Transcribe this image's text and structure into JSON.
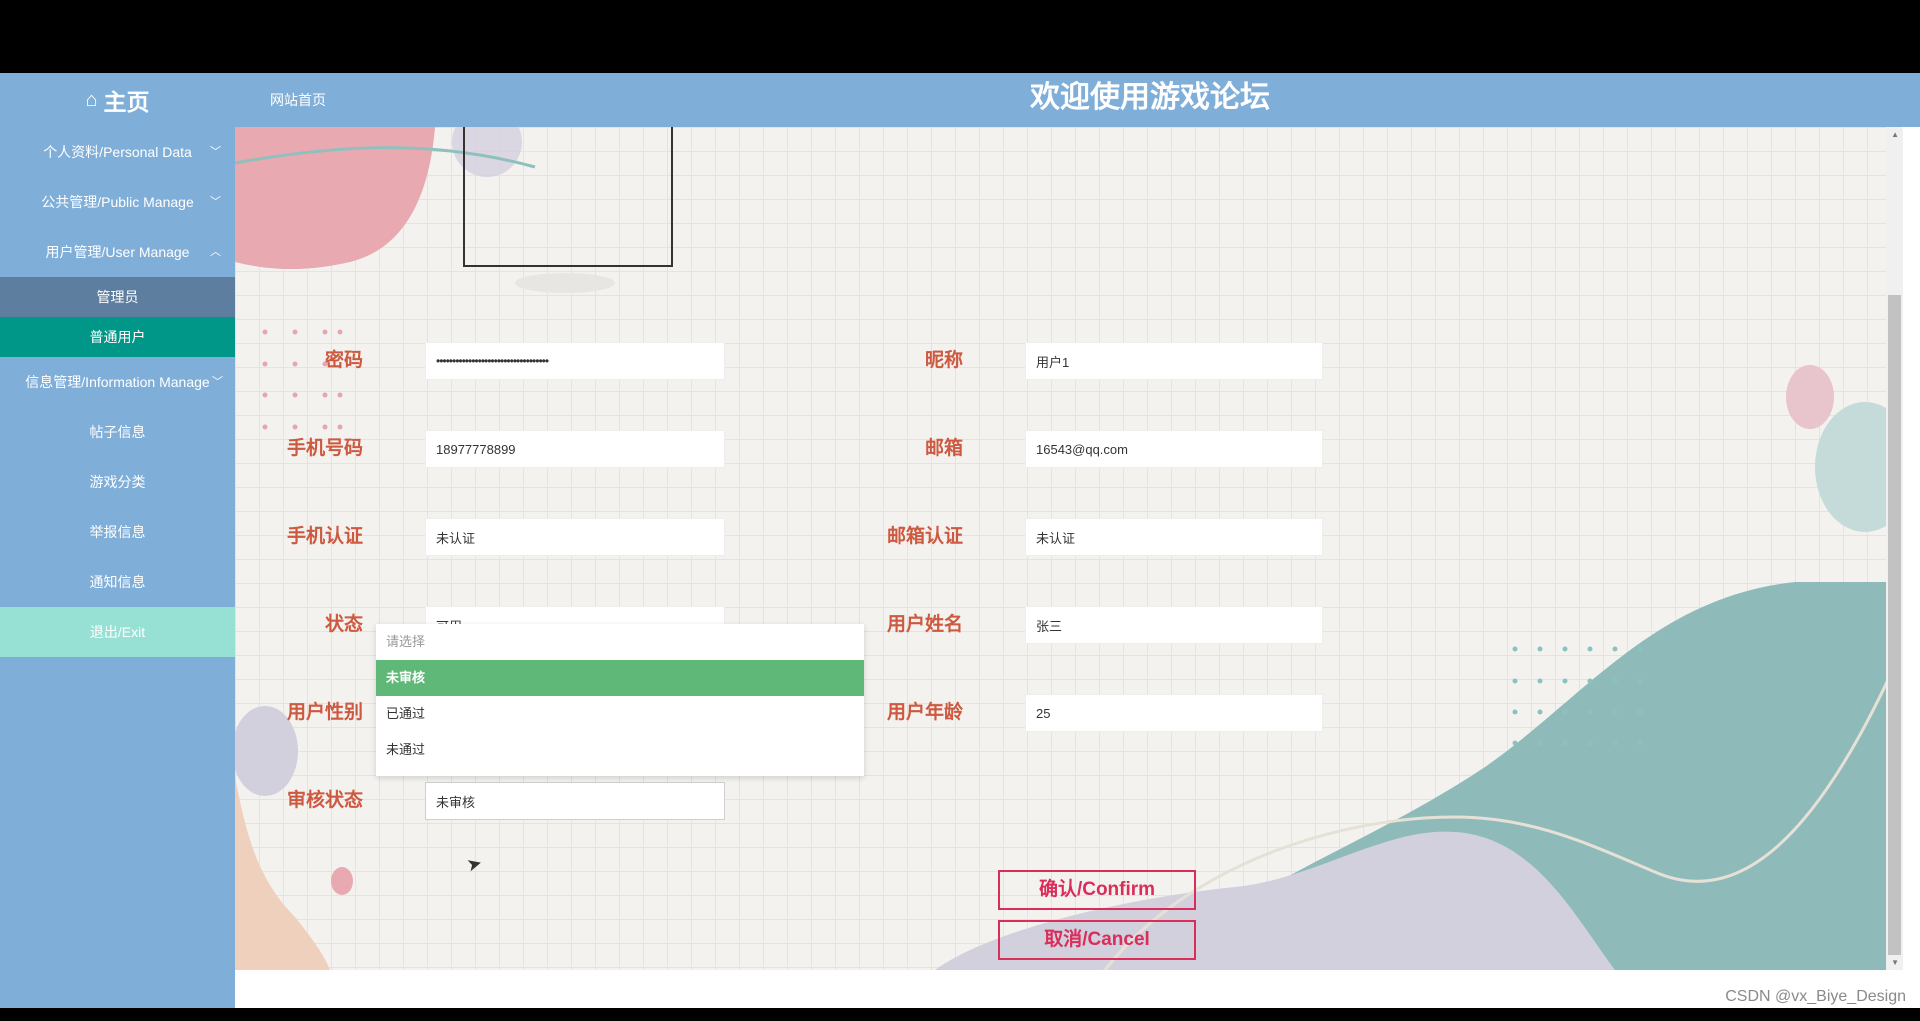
{
  "header": {
    "home_icon": "home-icon",
    "home_title": "主页",
    "site_link": "网站首页",
    "app_title": "欢迎使用游戏论坛"
  },
  "sidebar": {
    "personal": "个人资料/Personal Data",
    "public": "公共管理/Public Manage",
    "user": "用户管理/User Manage",
    "user_sub": [
      "管理员",
      "普通用户"
    ],
    "info": "信息管理/Information Manage",
    "info_sub": [
      "帖子信息",
      "游戏分类",
      "举报信息",
      "通知信息"
    ],
    "exit": "退出/Exit"
  },
  "form": {
    "password": {
      "label": "密码",
      "value": "•••••••••••••••••••••••••••••••••••"
    },
    "nickname": {
      "label": "昵称",
      "value": "用户1"
    },
    "phone": {
      "label": "手机号码",
      "value": "18977778899"
    },
    "email": {
      "label": "邮箱",
      "value": "16543@qq.com"
    },
    "phone_verify": {
      "label": "手机认证",
      "value": "未认证"
    },
    "email_verify": {
      "label": "邮箱认证",
      "value": "未认证"
    },
    "status": {
      "label": "状态",
      "value": "可用"
    },
    "real_name": {
      "label": "用户姓名",
      "value": "张三"
    },
    "gender": {
      "label": "用户性别"
    },
    "age": {
      "label": "用户年龄",
      "value": "25"
    },
    "audit": {
      "label": "审核状态",
      "value": "未审核"
    }
  },
  "audit_dropdown": {
    "placeholder": "请选择",
    "options": [
      "未审核",
      "已通过",
      "未通过"
    ],
    "selected_index": 0
  },
  "buttons": {
    "confirm": "确认/Confirm",
    "cancel": "取消/Cancel"
  },
  "watermark": "CSDN @vx_Biye_Design",
  "colors": {
    "header_bg": "#7faed9",
    "active_sub": "#009688",
    "exit_bg": "#97e0d4",
    "label": "#cc5940",
    "button": "#d92d5a",
    "dropdown_selected": "#5fb878"
  }
}
